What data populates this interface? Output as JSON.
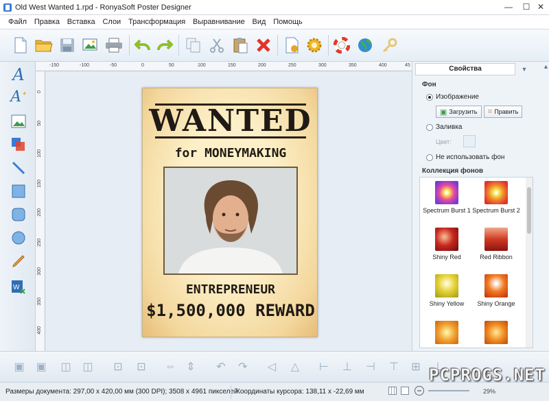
{
  "window": {
    "title": "Old West Wanted 1.rpd - RonyaSoft Poster Designer",
    "min_glyph": "—",
    "max_glyph": "☐",
    "close_glyph": "✕"
  },
  "menu": [
    "Файл",
    "Правка",
    "Вставка",
    "Слои",
    "Трансформация",
    "Выравнивание",
    "Вид",
    "Помощь"
  ],
  "toolbar": {
    "icons": [
      "new-file-icon",
      "open-folder-icon",
      "save-icon",
      "export-image-icon",
      "print-icon",
      "undo-icon",
      "redo-icon",
      "copy-icon",
      "cut-icon",
      "paste-icon",
      "delete-icon",
      "page-settings-icon",
      "gear-icon",
      "help-lifebuoy-icon",
      "globe-icon",
      "key-icon"
    ]
  },
  "left_tools": [
    "text-icon",
    "curved-text-icon",
    "image-icon",
    "clipart-icon",
    "line-icon",
    "rectangle-icon",
    "rounded-rectangle-icon",
    "ellipse-icon",
    "pencil-icon",
    "export-word-icon"
  ],
  "ruler": {
    "top": [
      "-150",
      "-100",
      "-50",
      "0",
      "50",
      "100",
      "150",
      "200",
      "250",
      "300",
      "350",
      "400",
      "45"
    ],
    "left": [
      "0",
      "50",
      "100",
      "150",
      "200",
      "250",
      "300",
      "350",
      "400"
    ]
  },
  "poster": {
    "headline": "WANTED",
    "subtitle": "for MONEYMAKING",
    "title": "ENTREPRENEUR",
    "reward": "$1,500,000 REWARD"
  },
  "properties": {
    "header": "Свойства",
    "background_section": "Фон",
    "option_image": "Изображение",
    "load_button": "Загрузить",
    "edit_button": "Править",
    "option_fill": "Заливка",
    "color_label": "Цвет:",
    "option_none": "Не использовать фон",
    "collection_title": "Коллекция фонов",
    "collection": [
      {
        "name": "Spectrum Burst 1",
        "color": "#e84aa0"
      },
      {
        "name": "Spectrum Burst 2",
        "color": "#f08a30"
      },
      {
        "name": "Shiny Red",
        "color": "#c8281e"
      },
      {
        "name": "Red Ribbon",
        "color": "#d13a24"
      },
      {
        "name": "Shiny Yellow",
        "color": "#e6d23a"
      },
      {
        "name": "Shiny Orange",
        "color": "#f07a22"
      },
      {
        "name": "",
        "color": "#f0a030"
      },
      {
        "name": "",
        "color": "#f08a20"
      }
    ]
  },
  "bottom_tools": [
    "bring-front-icon",
    "send-back-icon",
    "bring-forward-icon",
    "send-backward-icon",
    "group-icon",
    "ungroup-icon",
    "same-width-icon",
    "same-height-icon",
    "rotate-left-icon",
    "rotate-right-icon",
    "flip-horizontal-icon",
    "flip-vertical-icon",
    "align-left-icon",
    "align-center-icon",
    "align-right-icon",
    "align-top-icon",
    "align-middle-icon",
    "align-bottom-icon"
  ],
  "status": {
    "doc_size": "Размеры документа: 297,00 x 420,00 мм (300 DPI); 3508 x 4961 пикселей",
    "cursor": "Координаты курсора: 138,11 x -22,69 мм",
    "zoom": "29%"
  },
  "watermark": "PCPROGS.NET"
}
